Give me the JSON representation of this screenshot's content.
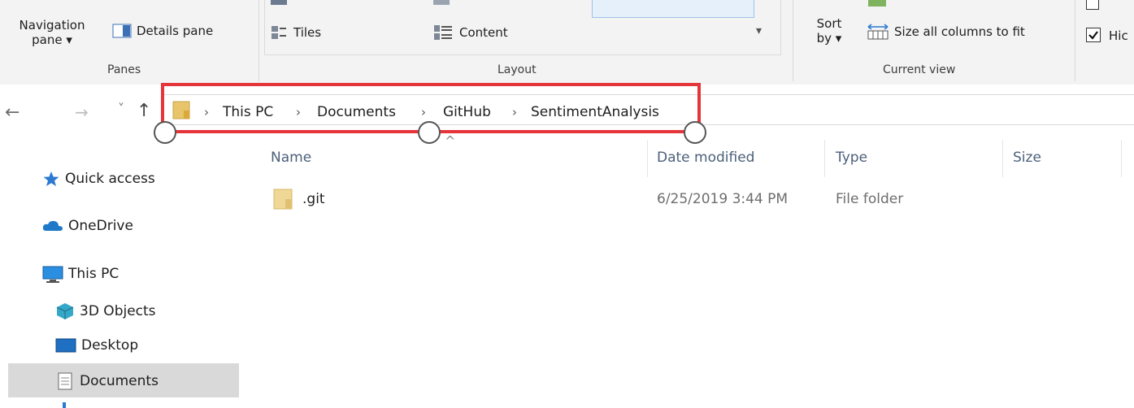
{
  "ribbon": {
    "panes": {
      "navigation_pane_line1": "Navigation",
      "navigation_pane_line2": "pane ▾",
      "details_pane": "Details pane",
      "group_label": "Panes"
    },
    "layout": {
      "tiles": "Tiles",
      "content": "Content",
      "group_label": "Layout"
    },
    "current_view": {
      "sort_by_line1": "Sort",
      "sort_by_line2": "by ▾",
      "size_all_columns": "Size all columns to fit",
      "group_label": "Current view"
    },
    "show_hide": {
      "checkbox_partial_label": "Hic"
    }
  },
  "navigation": {
    "back_icon": "←",
    "forward_icon": "→",
    "recent_icon": "˅",
    "up_icon": "↑"
  },
  "breadcrumb": {
    "items": [
      "This PC",
      "Documents",
      "GitHub",
      "SentimentAnalysis"
    ],
    "separator": "›"
  },
  "sidebar": {
    "items": [
      "Quick access",
      "OneDrive",
      "This PC",
      "3D Objects",
      "Desktop",
      "Documents"
    ],
    "selected": "Documents"
  },
  "file_list": {
    "columns": [
      "Name",
      "Date modified",
      "Type",
      "Size"
    ],
    "sort_indicator": "^",
    "rows": [
      {
        "name": ".git",
        "date_modified": "6/25/2019 3:44 PM",
        "type": "File folder",
        "size": ""
      }
    ]
  },
  "colors": {
    "highlight": "#e5343a",
    "folder": "#e8c46a",
    "onedrive": "#1f78c8",
    "selection": "#d9d9d9"
  }
}
